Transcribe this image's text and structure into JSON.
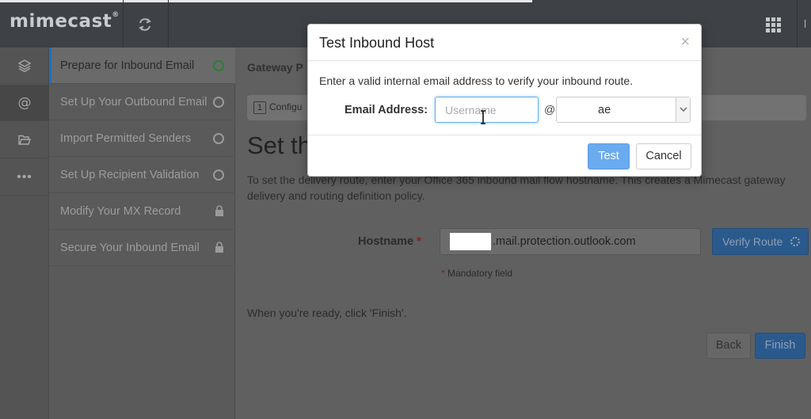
{
  "header": {
    "brand": "mimecast",
    "brand_mark": "®",
    "corner_char": "l"
  },
  "steps": [
    {
      "label": "Prepare for Inbound Email",
      "status": "current"
    },
    {
      "label": "Set Up Your Outbound Email",
      "status": "pending"
    },
    {
      "label": "Import Permitted Senders",
      "status": "pending"
    },
    {
      "label": "Set Up Recipient Validation",
      "status": "pending"
    },
    {
      "label": "Modify Your MX Record",
      "status": "locked"
    },
    {
      "label": "Secure Your Inbound Email",
      "status": "locked"
    }
  ],
  "main": {
    "breadcrumb": "Gateway P",
    "progress_step_number": "1",
    "progress_step_label": "Configu",
    "section_title": "Set th",
    "intro": "To set the delivery route, enter your Office 365 inbound mail flow hostname. This creates a Mimecast gateway delivery and routing definition policy.",
    "hostname_label": "Hostname",
    "required_mark": "*",
    "hostname_value": ".mail.protection.outlook.com",
    "verify_button": "Verify Route",
    "mandatory_note": "Mandatory field",
    "ready_text": "When you're ready, click 'Finish'.",
    "back_button": "Back",
    "finish_button": "Finish"
  },
  "modal": {
    "title": "Test Inbound Host",
    "close": "×",
    "description": "Enter a valid internal email address to verify your inbound route.",
    "email_label": "Email Address:",
    "username_placeholder": "Username",
    "at_sign": "@",
    "domain_value": "ae",
    "test_button": "Test",
    "cancel_button": "Cancel"
  },
  "colors": {
    "topbar": "#3e4246",
    "accent_blue": "#6aaaee",
    "step_complete_green": "#2e7d32"
  },
  "icons": [
    "sync-icon",
    "apps-grid-icon",
    "layers-icon",
    "at-icon",
    "folder-icon",
    "more-icon",
    "lock-icon",
    "chevron-down-icon",
    "text-cursor-icon"
  ]
}
